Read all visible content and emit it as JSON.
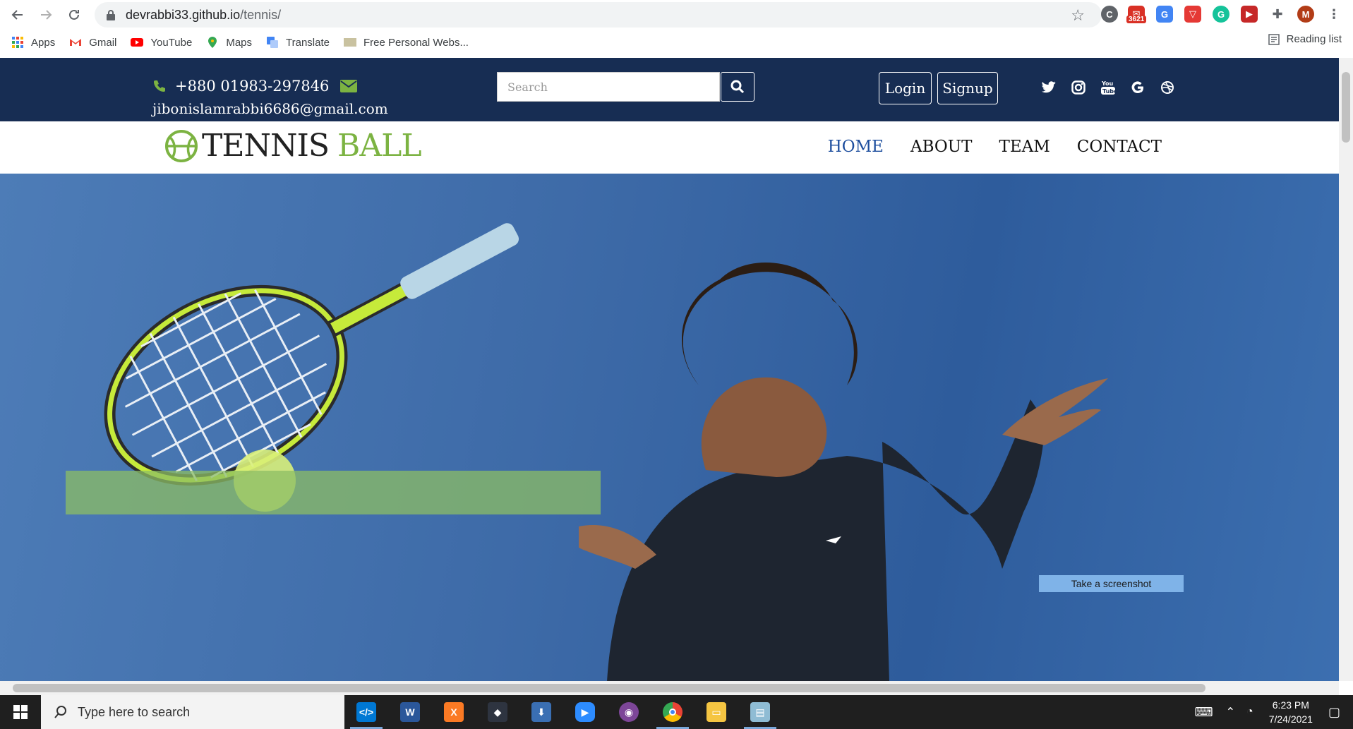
{
  "browser": {
    "url_host": "devrabbi33.github.io",
    "url_path": "/tennis/",
    "bookmarks": [
      {
        "label": "Apps"
      },
      {
        "label": "Gmail"
      },
      {
        "label": "YouTube"
      },
      {
        "label": "Maps"
      },
      {
        "label": "Translate"
      },
      {
        "label": "Free Personal Webs..."
      }
    ],
    "reading_list": "Reading list",
    "mail_badge": "3621"
  },
  "site": {
    "phone": "+880 01983-297846",
    "email": "jibonislamrabbi6686@gmail.com",
    "search_placeholder": "Search",
    "login": "Login",
    "signup": "Signup",
    "logo_dark": "TENNIS",
    "logo_green": "BALL",
    "menu": [
      "HOME",
      "ABOUT",
      "TEAM",
      "CONTACT"
    ],
    "screenshot_button": "Take a screenshot",
    "colors": {
      "topbar": "#172d53",
      "accent_green": "#7cb342",
      "active_link": "#1d4e9e"
    }
  },
  "taskbar": {
    "search_placeholder": "Type here to search",
    "time": "6:23 PM",
    "date": "7/24/2021"
  }
}
